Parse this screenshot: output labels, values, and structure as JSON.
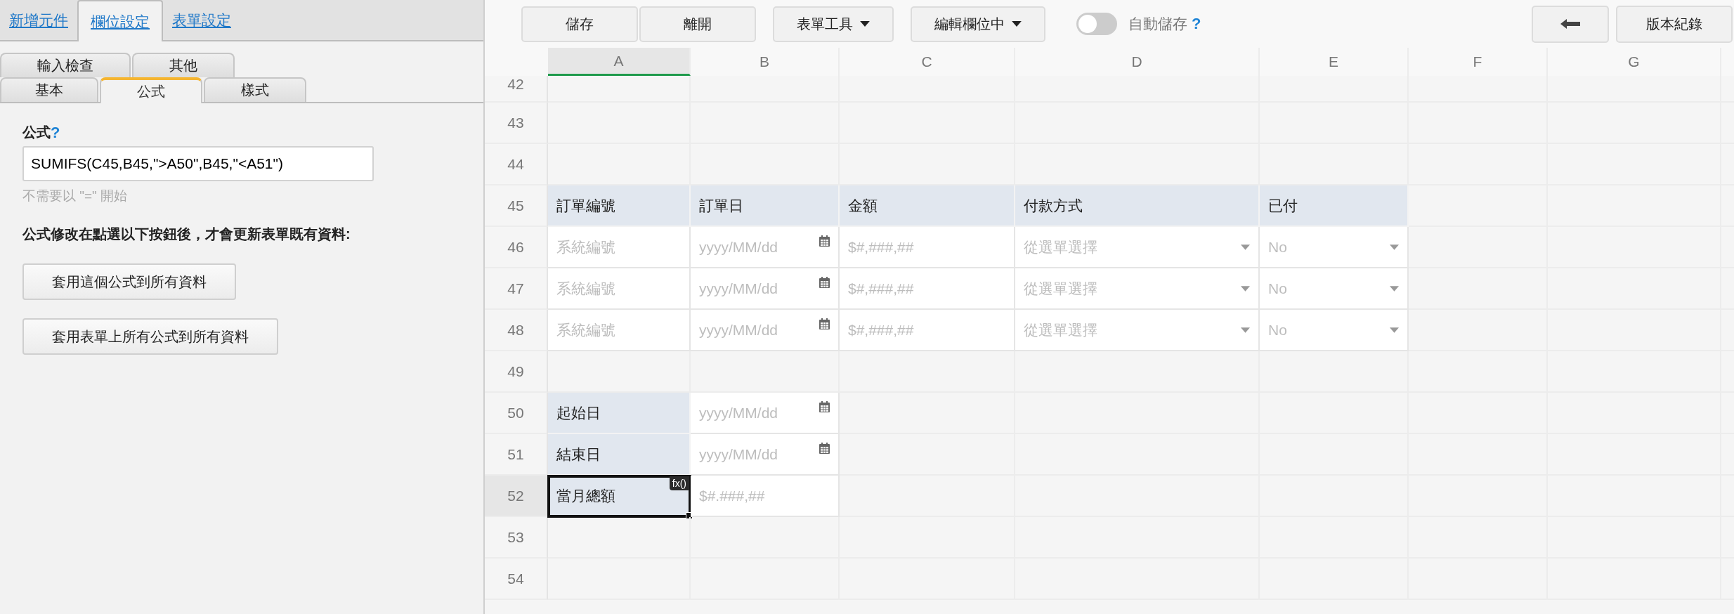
{
  "left_panel": {
    "top_tabs": [
      {
        "label": "新增元件",
        "selected": false
      },
      {
        "label": "欄位設定",
        "selected": true
      },
      {
        "label": "表單設定",
        "selected": false
      }
    ],
    "sub_tabs": [
      [
        {
          "label": "輸入檢查",
          "selected": false
        },
        {
          "label": "其他",
          "selected": false
        }
      ],
      [
        {
          "label": "基本",
          "selected": false
        },
        {
          "label": "公式",
          "selected": true
        },
        {
          "label": "樣式",
          "selected": false
        }
      ]
    ],
    "formula_label": "公式",
    "formula_help": "?",
    "formula_value": "SUMIFS(C45,B45,\">A50\",B45,\"<A51\")",
    "formula_hint": "不需要以 \"=\" 開始",
    "note": "公式修改在點選以下按鈕後，才會更新表單既有資料:",
    "buttons": [
      "套用這個公式到所有資料",
      "套用表單上所有公式到所有資料"
    ]
  },
  "toolbar": {
    "buttons": [
      {
        "label": "儲存",
        "kind": "plain"
      },
      {
        "label": "離開",
        "kind": "plain"
      },
      {
        "label": "表單工具",
        "kind": "dropdown"
      },
      {
        "label": "編輯欄位中",
        "kind": "dropdown"
      }
    ],
    "toggle": {
      "on": false,
      "label": "自動儲存",
      "help": "?"
    },
    "right_buttons": [
      {
        "kind": "back"
      },
      {
        "kind": "text",
        "label": "版本紀錄"
      }
    ]
  },
  "grid": {
    "columns": [
      {
        "label": "A",
        "selected": true
      },
      {
        "label": "B",
        "selected": false
      },
      {
        "label": "C",
        "selected": false
      },
      {
        "label": "D",
        "selected": false
      },
      {
        "label": "E",
        "selected": false
      },
      {
        "label": "F",
        "selected": false
      },
      {
        "label": "G",
        "selected": false
      }
    ],
    "rows": [
      {
        "number": "42",
        "selected": false
      },
      {
        "number": "43",
        "selected": false
      },
      {
        "number": "44",
        "selected": false
      },
      {
        "number": "45",
        "selected": false,
        "cells": [
          {
            "kind": "label",
            "text": "訂單編號"
          },
          {
            "kind": "label",
            "text": "訂單日"
          },
          {
            "kind": "label",
            "text": "金額"
          },
          {
            "kind": "label",
            "text": "付款方式"
          },
          {
            "kind": "label",
            "text": "已付"
          }
        ]
      },
      {
        "number": "46",
        "selected": false,
        "cells": [
          {
            "kind": "input",
            "text": "系統編號"
          },
          {
            "kind": "date_input",
            "text": "yyyy/MM/dd"
          },
          {
            "kind": "input",
            "text": "$#,###,##"
          },
          {
            "kind": "select_input",
            "text": "從選單選擇"
          },
          {
            "kind": "select_input",
            "text": "No"
          }
        ]
      },
      {
        "number": "47",
        "selected": false,
        "cells": [
          {
            "kind": "input",
            "text": "系統編號"
          },
          {
            "kind": "date_input",
            "text": "yyyy/MM/dd"
          },
          {
            "kind": "input",
            "text": "$#,###,##"
          },
          {
            "kind": "select_input",
            "text": "從選單選擇"
          },
          {
            "kind": "select_input",
            "text": "No"
          }
        ]
      },
      {
        "number": "48",
        "selected": false,
        "cells": [
          {
            "kind": "input",
            "text": "系統編號"
          },
          {
            "kind": "date_input",
            "text": "yyyy/MM/dd"
          },
          {
            "kind": "input",
            "text": "$#,###,##"
          },
          {
            "kind": "select_input",
            "text": "從選單選擇"
          },
          {
            "kind": "select_input",
            "text": "No"
          }
        ]
      },
      {
        "number": "49",
        "selected": false
      },
      {
        "number": "50",
        "selected": false,
        "cells": [
          {
            "kind": "label",
            "text": "起始日"
          },
          {
            "kind": "date_input",
            "text": "yyyy/MM/dd"
          }
        ]
      },
      {
        "number": "51",
        "selected": false,
        "cells": [
          {
            "kind": "label",
            "text": "結束日"
          },
          {
            "kind": "date_input",
            "text": "yyyy/MM/dd"
          }
        ]
      },
      {
        "number": "52",
        "selected": true,
        "cells": [
          {
            "kind": "label",
            "text": "當月總額",
            "selected": true,
            "badge": "fx()"
          },
          {
            "kind": "input",
            "text": "$#.###,##"
          }
        ]
      },
      {
        "number": "53",
        "selected": false
      },
      {
        "number": "54",
        "selected": false
      }
    ]
  }
}
